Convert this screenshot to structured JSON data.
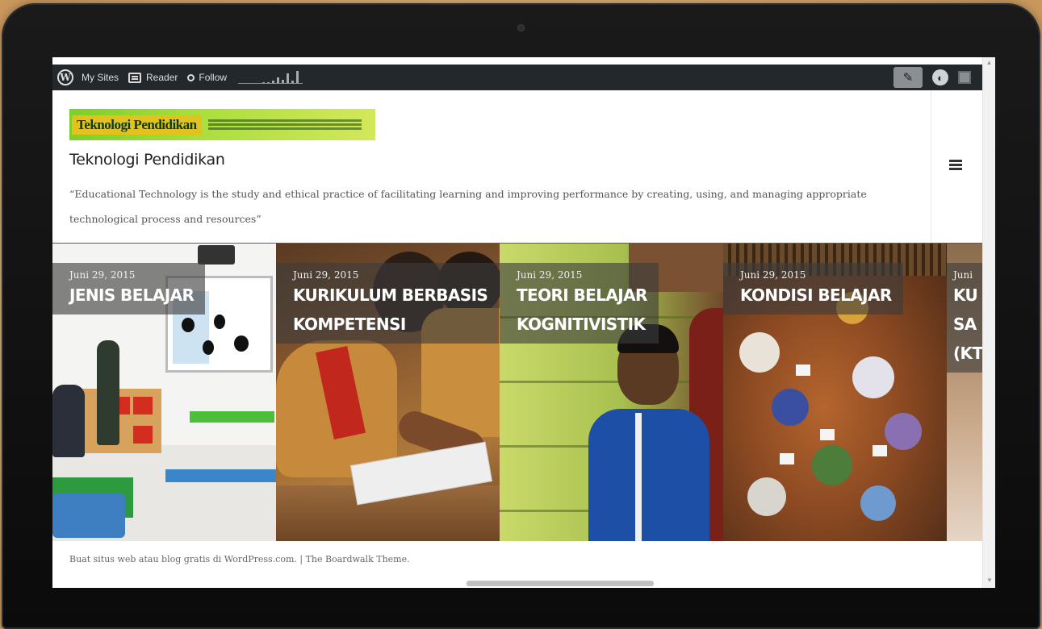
{
  "admin_bar": {
    "my_sites": "My Sites",
    "reader": "Reader",
    "follow": "Follow",
    "sparkline_values": [
      1,
      1,
      2,
      5,
      3,
      9,
      2,
      11
    ],
    "icons": [
      "wordpress-logo-icon",
      "reader-icon",
      "follow-icon",
      "write-icon",
      "notifications-icon",
      "avatar"
    ]
  },
  "header": {
    "logo_title": "Teknologi Pendidikan",
    "site_title": "Teknologi Pendidikan",
    "tagline": "“Educational Technology is the study and ethical practice of facilitating learning and improving performance by creating, using, and managing appropriate technological process and resources”"
  },
  "posts": [
    {
      "date": "Juni 29, 2015",
      "title": "JENIS BELAJAR"
    },
    {
      "date": "Juni 29, 2015",
      "title": "KURIKULUM BERBASIS\nKOMPETENSI"
    },
    {
      "date": "Juni 29, 2015",
      "title": "TEORI BELAJAR\nKOGNITIVISTIK"
    },
    {
      "date": "Juni 29, 2015",
      "title": "KONDISI BELAJAR"
    },
    {
      "date": "Juni",
      "title": "KU\nSA\n(KT"
    }
  ],
  "footer": {
    "text": "Buat situs web atau blog gratis di WordPress.com. | The Boardwalk Theme."
  },
  "colors": {
    "admin_bar": "#23282d",
    "accent_line": "#c92a2a",
    "logo_green": "#a9dd3c"
  }
}
